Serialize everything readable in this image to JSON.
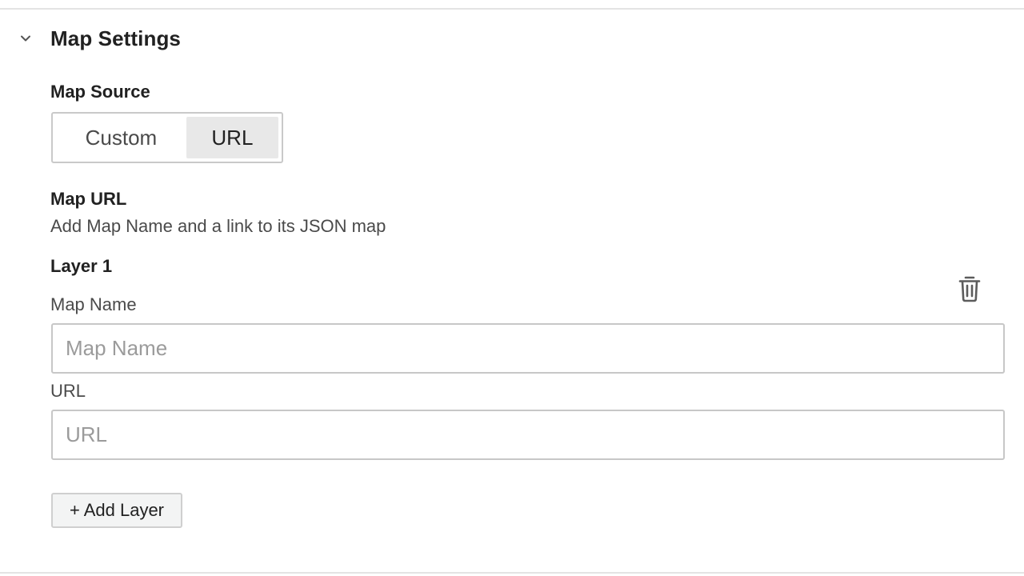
{
  "section": {
    "title": "Map Settings",
    "expanded": true,
    "chevron_icon": "chevron-down-icon"
  },
  "map_source": {
    "label": "Map Source",
    "options": [
      "Custom",
      "URL"
    ],
    "selected": "URL"
  },
  "map_url": {
    "label": "Map URL",
    "description": "Add Map Name and a link to its JSON map"
  },
  "layers": [
    {
      "title": "Layer 1",
      "name_label": "Map Name",
      "name_placeholder": "Map Name",
      "name_value": "",
      "url_label": "URL",
      "url_placeholder": "URL",
      "url_value": "",
      "delete_icon": "trash-icon"
    }
  ],
  "add_layer_label": "+ Add Layer",
  "colors": {
    "text": "#212121",
    "muted_text": "#4a4a4a",
    "placeholder": "#9b9b9b",
    "border": "#c7c7c7",
    "selected_segment": "#e8e8e8",
    "button_bg": "#f3f4f4"
  }
}
